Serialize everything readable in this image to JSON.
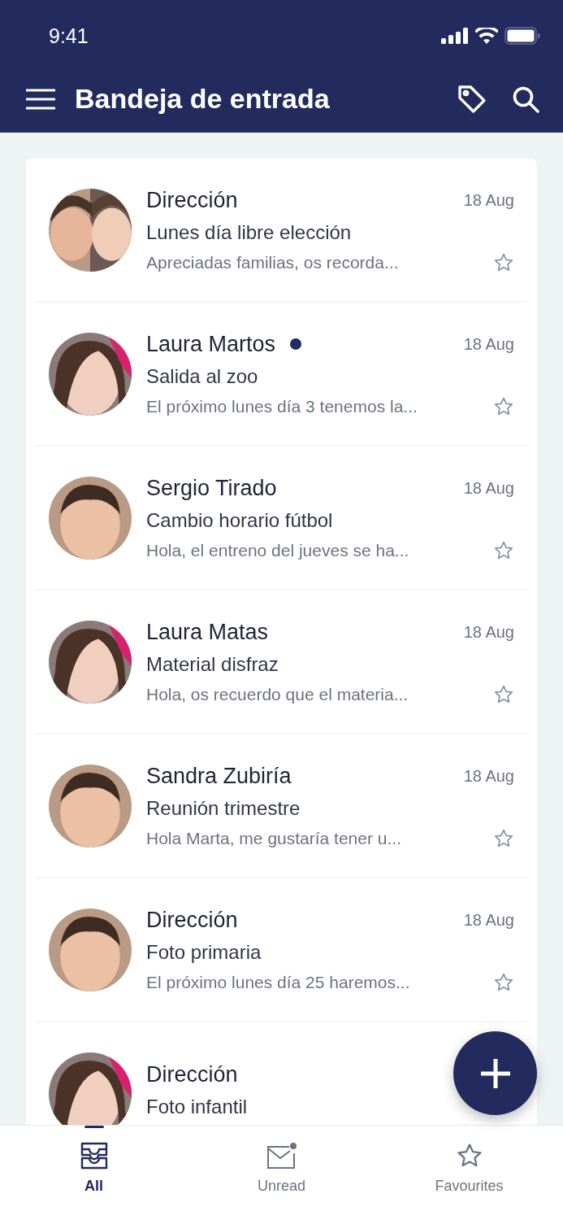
{
  "status_bar": {
    "time": "9:41"
  },
  "header": {
    "title": "Bandeja de entrada"
  },
  "messages": [
    {
      "sender": "Dirección",
      "date": "18 Aug",
      "subject": "Lunes día libre elección",
      "preview": "Apreciadas familias, os recorda...",
      "unread": false,
      "starred": false
    },
    {
      "sender": "Laura Martos",
      "date": "18 Aug",
      "subject": "Salida al zoo",
      "preview": "El próximo lunes día 3 tenemos la...",
      "unread": true,
      "starred": false
    },
    {
      "sender": "Sergio Tirado",
      "date": "18 Aug",
      "subject": "Cambio horario fútbol",
      "preview": "Hola, el entreno del jueves se ha...",
      "unread": false,
      "starred": false
    },
    {
      "sender": "Laura Matas",
      "date": "18 Aug",
      "subject": "Material disfraz",
      "preview": "Hola, os recuerdo que el materia...",
      "unread": false,
      "starred": false
    },
    {
      "sender": "Sandra Zubiría",
      "date": "18 Aug",
      "subject": "Reunión trimestre",
      "preview": "Hola Marta, me gustaría tener u...",
      "unread": false,
      "starred": false
    },
    {
      "sender": "Dirección",
      "date": "18 Aug",
      "subject": "Foto primaria",
      "preview": "El próximo lunes día 25 haremos...",
      "unread": false,
      "starred": false
    },
    {
      "sender": "Dirección",
      "subject": "Foto infantil",
      "unread": false
    }
  ],
  "tabs": [
    {
      "label": "All",
      "selected": true
    },
    {
      "label": "Unread",
      "selected": false
    },
    {
      "label": "Favourites",
      "selected": false
    }
  ]
}
